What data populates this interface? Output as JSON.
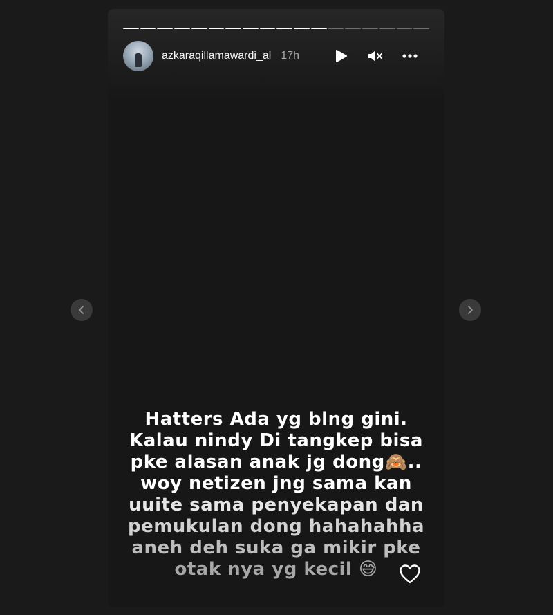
{
  "story": {
    "username": "azkaraqillamawardi_al",
    "time_ago": "17h",
    "progress": {
      "total_segments": 18,
      "completed_segments": 12
    },
    "caption_lines": [
      "Hatters Ada yg blng gini.",
      "Kalau nindy Di tangkep bisa",
      "pke alasan anak jg dong🙈..",
      "woy netizen jng sama kan",
      "uuite sama penyekapan dan",
      "pemukulan dong hahahahha",
      "aneh deh suka ga mikir pke",
      "otak nya yg kecil 😅"
    ]
  },
  "icons": {
    "play": "play-icon",
    "mute": "volume-muted-icon",
    "more": "more-options-icon",
    "like": "heart-icon",
    "prev": "chevron-left-icon",
    "next": "chevron-right-icon"
  },
  "colors": {
    "page_bg": "#1a1a1a",
    "story_bg": "#171717",
    "text": "#ffffff",
    "muted_text": "#a8a8a8"
  }
}
